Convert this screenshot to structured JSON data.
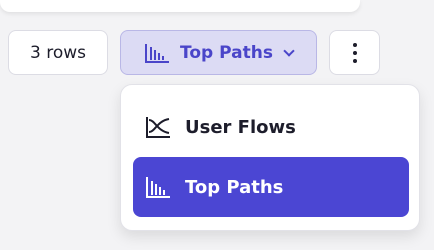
{
  "toolbar": {
    "rows_label": "3 rows",
    "view_label": "Top Paths",
    "view_icon": "bar-chart-icon",
    "more_icon": "vertical-ellipsis-icon"
  },
  "menu": {
    "items": [
      {
        "label": "User Flows",
        "icon": "flows-icon",
        "selected": false
      },
      {
        "label": "Top Paths",
        "icon": "bar-chart-icon",
        "selected": true
      }
    ]
  },
  "colors": {
    "accent": "#4b46d3",
    "accent_light": "#dcdbf4",
    "text": "#1d1d2b"
  }
}
